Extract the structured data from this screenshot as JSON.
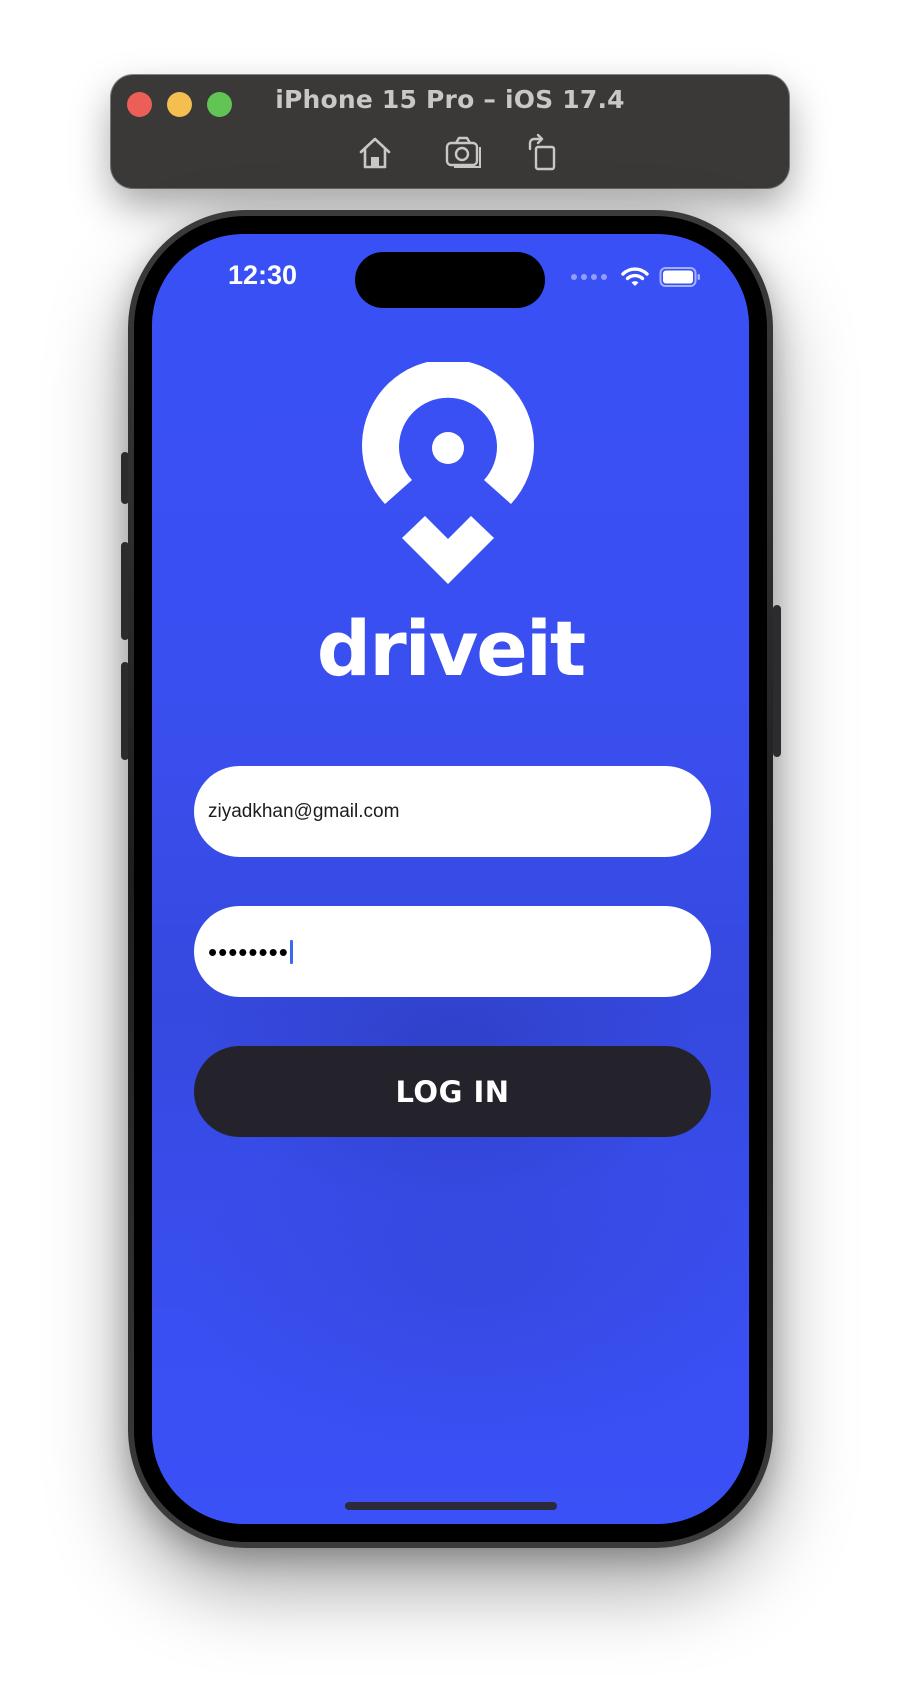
{
  "simulator": {
    "title": "iPhone 15 Pro – iOS 17.4",
    "toolbar": {
      "home_icon": "home-icon",
      "screenshot_icon": "camera-icon",
      "rotate_icon": "rotate-icon"
    },
    "traffic_lights": [
      "#ec5f57",
      "#f4bf4f",
      "#61c454"
    ]
  },
  "status_bar": {
    "time": "12:30",
    "icons": [
      "signal-icon",
      "wifi-icon",
      "battery-icon"
    ]
  },
  "app": {
    "brand": "driveit",
    "logo_icon": "location-pin-icon",
    "accent_color": "#374ff5",
    "button_color": "#24232b"
  },
  "login_form": {
    "email_value": "ziyadkhan@gmail.com",
    "password_value": "••••••••",
    "login_label": "LOG IN"
  }
}
